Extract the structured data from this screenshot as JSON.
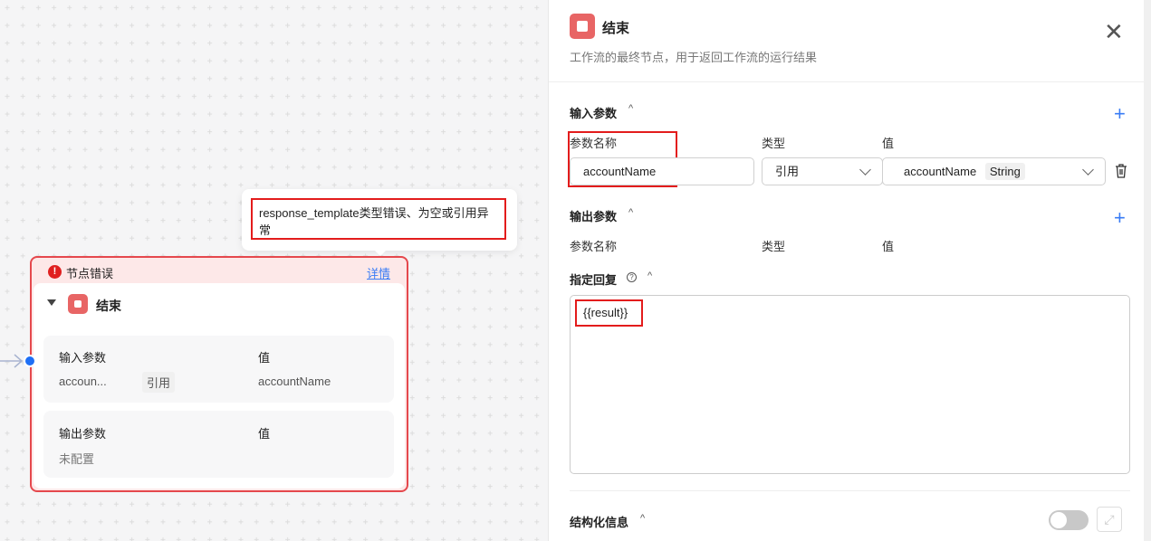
{
  "canvas": {
    "tooltip": {
      "message": "response_template类型错误、为空或引用异常"
    },
    "node": {
      "error_label": "节点错误",
      "details_link": "详情",
      "title": "结束",
      "input_section": {
        "header": "输入参数",
        "value_header": "值",
        "rows": [
          {
            "name": "accoun...",
            "type": "引用",
            "value": "accountName"
          }
        ]
      },
      "output_section": {
        "header": "输出参数",
        "value_header": "值",
        "empty": "未配置"
      }
    }
  },
  "panel": {
    "title": "结束",
    "description": "工作流的最终节点，用于返回工作流的运行结果",
    "input_params": {
      "header": "输入参数",
      "col_name": "参数名称",
      "col_type": "类型",
      "col_value": "值",
      "rows": [
        {
          "name": "accountName",
          "type": "引用",
          "value": "accountName",
          "value_type": "String"
        }
      ]
    },
    "output_params": {
      "header": "输出参数",
      "col_name": "参数名称",
      "col_type": "类型",
      "col_value": "值"
    },
    "reply": {
      "header": "指定回复",
      "content": "{{result}}"
    },
    "structured": {
      "header": "结构化信息",
      "enabled": false
    }
  },
  "colors": {
    "accent": "#3a7cf5",
    "error": "#e5484d",
    "node_icon": "#e86565"
  }
}
